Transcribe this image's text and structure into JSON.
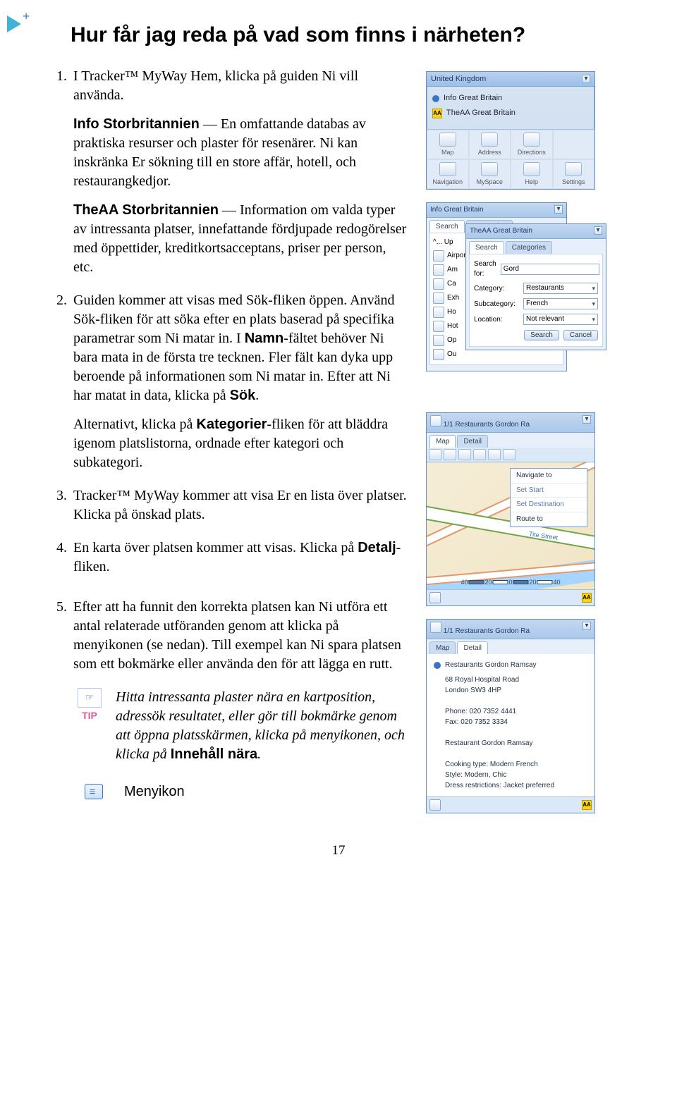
{
  "heading": "Hur får jag reda på vad som finns i närheten?",
  "step1": {
    "num": "1.",
    "intro": "I Tracker™ MyWay Hem, klicka på guiden Ni vill använda.",
    "info_sb_bold": "Info Storbritannien",
    "info_sb_rest": " — En omfattande databas av praktiska resurser och plaster för resenärer. Ni kan inskränka Er sökning till en store affär, hotell, och restaurangkedjor.",
    "theaa_bold": "TheAA Storbritannien",
    "theaa_rest": " —  Information om valda typer av intressanta platser, innefattande fördjupade redogörelser med öppettider, kreditkortsacceptans, priser per person, etc."
  },
  "step2": {
    "num": "2.",
    "t1": "Guiden kommer att visas med Sök-fliken öppen. Använd Sök-fliken för att söka efter en plats baserad på specifika parametrar som Ni matar in. I ",
    "namn_bold": "Namn",
    "t2": "-fältet behöver Ni bara mata in de första tre tecknen. Fler fält kan dyka upp beroende på informationen som Ni matar in. Efter att Ni har matat in data, klicka på ",
    "sok_bold": "Sök",
    "t3": ".",
    "alt1": "Alternativt, klicka på ",
    "kat_bold": "Kategorier",
    "alt2": "-fliken för att bläddra igenom platslistorna, ordnade efter kategori och subkategori."
  },
  "step3": {
    "num": "3.",
    "text": "Tracker™ MyWay kommer att visa Er en lista över platser. Klicka på önskad plats."
  },
  "step4": {
    "num": "4.",
    "t1": "En karta över platsen kommer att visas. Klicka på ",
    "detalj_bold": "Detalj",
    "t2": "-fliken."
  },
  "step5": {
    "num": "5.",
    "text": "Efter att ha funnit den korrekta platsen kan Ni utföra ett antal relaterade utföranden genom att klicka på menyikonen (se nedan). Till exempel kan Ni spara platsen som ett bokmärke eller använda den för att lägga en rutt."
  },
  "tip": {
    "label": "TIP",
    "t1": "Hitta intressanta plaster nära en kartposition, adressök resultatet, eller gör till bokmärke genom att öppna platsskärmen, klicka på menyikonen, och klicka på ",
    "innehall_bold": "Innehåll nära",
    "t2": "."
  },
  "menyikon_label": "Menyikon",
  "page_number": "17",
  "panel1": {
    "title": "United Kingdom",
    "items": [
      "Info Great Britain",
      "TheAA Great Britain"
    ],
    "nav": [
      "Map",
      "Address",
      "Directions",
      ""
    ],
    "nav2": [
      "Navigation",
      "MySpace",
      "Help",
      "Settings"
    ]
  },
  "panel2": {
    "back_title": "Info Great Britain",
    "back_tabs": [
      "Search",
      "Categories"
    ],
    "back_up": "^... Up",
    "back_rows": [
      "Airport",
      "Am",
      "Ca",
      "Exh",
      "Ho",
      "Hot",
      "Op",
      "Ou"
    ],
    "front_title": "TheAA Great Britain",
    "front_tabs": [
      "Search",
      "Categories"
    ],
    "searchfor_label": "Search for:",
    "searchfor_val": "Gord",
    "cat_label": "Category:",
    "cat_val": "Restaurants",
    "sub_label": "Subcategory:",
    "sub_val": "French",
    "loc_label": "Location:",
    "loc_val": "Not relevant",
    "btn_search": "Search",
    "btn_cancel": "Cancel"
  },
  "panel3": {
    "title": "1/1 Restaurants Gordon Ra",
    "tabs": [
      "Map",
      "Detail"
    ],
    "menu": [
      "Navigate to",
      "Set Start",
      "Set Destination",
      "Route to"
    ],
    "scale": [
      "40",
      "20",
      "0",
      "20",
      "40"
    ],
    "street": "Tite Street"
  },
  "panel4": {
    "title": "1/1 Restaurants Gordon Ra",
    "tabs": [
      "Map",
      "Detail"
    ],
    "name": "Restaurants Gordon Ramsay",
    "addr1": "68 Royal Hospital Road",
    "addr2": "London SW3 4HP",
    "phone": "Phone: 020 7352 4441",
    "fax": "Fax: 020 7352 3334",
    "rname": "Restaurant Gordon Ramsay",
    "ctype": "Cooking type: Modern French",
    "style": "Style: Modern, Chic",
    "dress": "Dress restrictions: Jacket preferred"
  }
}
